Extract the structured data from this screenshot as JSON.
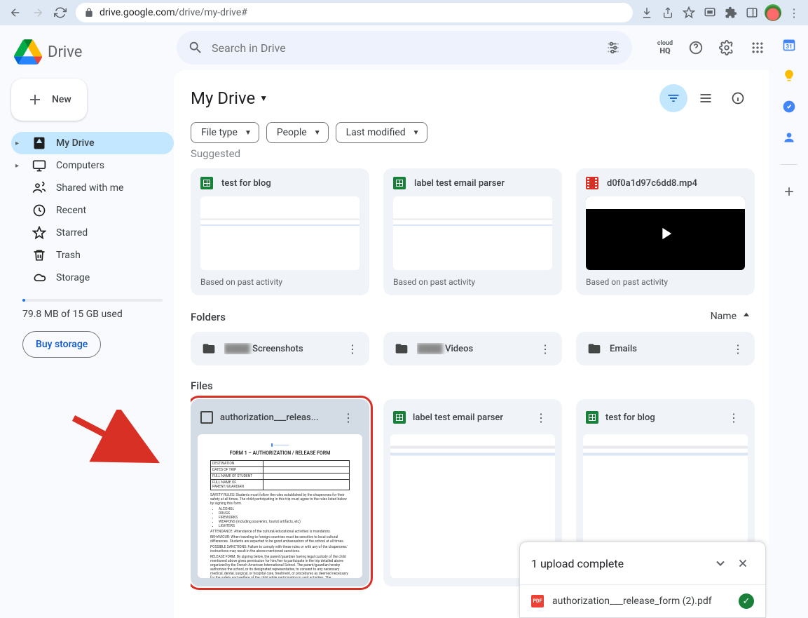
{
  "browser": {
    "url_host": "drive.google.com",
    "url_path": "/drive/my-drive#"
  },
  "logo_text": "Drive",
  "new_btn": "New",
  "nav": {
    "my_drive": "My Drive",
    "computers": "Computers",
    "shared": "Shared with me",
    "recent": "Recent",
    "starred": "Starred",
    "trash": "Trash",
    "storage": "Storage"
  },
  "storage_text": "79.8 MB of 15 GB used",
  "buy_storage": "Buy storage",
  "search_placeholder": "Search in Drive",
  "hq_label": "cloud HQ",
  "page_title": "My Drive",
  "chips": {
    "file_type": "File type",
    "people": "People",
    "last_modified": "Last modified"
  },
  "suggested_label": "Suggested",
  "suggested": [
    {
      "title": "test for blog",
      "sub": "Based on past activity",
      "type": "sheet"
    },
    {
      "title": "label test email parser",
      "sub": "Based on past activity",
      "type": "sheet"
    },
    {
      "title": "d0f0a1d97c6dd8.mp4",
      "sub": "Based on past activity",
      "type": "video"
    }
  ],
  "folders_label": "Folders",
  "sort_label": "Name",
  "folders": [
    {
      "name": "Screenshots",
      "prefix": "████"
    },
    {
      "name": "Videos",
      "prefix": "████"
    },
    {
      "name": "Emails",
      "prefix": ""
    }
  ],
  "files_label": "Files",
  "files": [
    {
      "title": "authorization___releas...",
      "type": "pdf_highlight"
    },
    {
      "title": "label test email parser",
      "type": "sheet"
    },
    {
      "title": "test for blog",
      "type": "sheet"
    }
  ],
  "pdf_preview": {
    "title": "FORM 1 – AUTHORIZATION / RELEASE FORM",
    "rows": [
      "DESTINATION",
      "DATES OF TRIP",
      "FULL NAME OF STUDENT",
      "FULL NAME OF PARENT/GUARDIAN"
    ],
    "safety": "SAFETY RULES: Students must follow the rules established by the chaperones for their safety at all times. The child participating in this trip must agree to the rules listed below by signing this form.",
    "bullets": [
      "ALCOHOL",
      "DRUGS",
      "FIREWORKS",
      "WEAPONS (including souvenirs, tourist artifacts, etc)",
      "LIGHTERS"
    ],
    "attendance": "ATTENDANCE: Attendance of the cultural/educational activities is mandatory.",
    "behaviour": "BEHAVIOUR: When traveling to foreign countries must be sensitive to local cultural differences. Students are expected to be good ambassadors of the school at all times.",
    "sanctions": "POSSIBLE SANCTIONS: Failure to comply with these rules or with any of the chaperones' instructions may result in the above-mentioned sanctions.",
    "release": "RELEASE FORM: By signing below, the parent/guardian having legal custody of the child mentioned above gives permission for him/her to participate in the trip detailed above organized by the French American International School. The parent/guardian hereby authorizes the school, or its designated representative, to consent to any necessary medical, dental, surgical, or hospital care, treatment, or procedures as deemed necessary for the safety and welfare of the child while participating in said activities. The parent/guardian further authorizes the school to resume physical custody of the child upon"
  },
  "toast": {
    "title": "1 upload complete",
    "file": "authorization___release_form (2).pdf"
  }
}
